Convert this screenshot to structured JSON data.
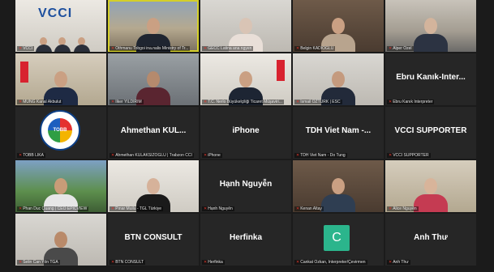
{
  "tiles": [
    {
      "name": "VCCI"
    },
    {
      "name": "Othmanu Tobgoi ina.nalis Ministry of Tr..."
    },
    {
      "name": "GECC Latina ana ngyen"
    },
    {
      "name": "Belgin KADIOGLU"
    },
    {
      "name": "Alper Özel"
    },
    {
      "name": "MÜNG Kanal Akbulut"
    },
    {
      "name": "İlker YILDIRIM"
    },
    {
      "name": "T.C. Nerlo Büyükelçiliği Ticaret Müşaviri..."
    },
    {
      "name": "İsmail ÖZTÜRK | ESC"
    },
    {
      "name": "Ebru Kanık Interpreter",
      "big": "Ebru Kanık-Inter..."
    },
    {
      "name": "TOBB LİKA",
      "logo": "TOBB"
    },
    {
      "name": "Ahmethan KULAKSIZOĞLU | Trabzon CCI",
      "big": "Ahmethan KUL..."
    },
    {
      "name": "iPhone",
      "big": "iPhone"
    },
    {
      "name": "TDH Viet Nam - Do Tung",
      "big": "TDH Viet Nam -..."
    },
    {
      "name": "VCCI SUPPORTER",
      "big": "VCCI SUPPORTER"
    },
    {
      "name": "Phan Duc Quang | CEO EPICVIEW"
    },
    {
      "name": "Pınar Muilu - TGL Türkiye"
    },
    {
      "name": "Hạnh Nguyễn",
      "big": "Hạnh Nguyễn"
    },
    {
      "name": "Kenan Altay"
    },
    {
      "name": "Alice Nguyễn"
    },
    {
      "name": "Selin Can Yön TGA"
    },
    {
      "name": "BTN CONSULT",
      "big": "BTN CONSULT"
    },
    {
      "name": "Herfinka",
      "big": "Herfinka"
    },
    {
      "name": "Cankat Özkan, Interpreter/Çevirmen",
      "avatar": "C"
    },
    {
      "name": "Anh Thư",
      "big": "Anh Thư"
    }
  ],
  "colors": {
    "active_border": "#d4cf2a",
    "mic_muted": "#e0352b",
    "avatar_bg": "#2bb58c"
  },
  "icons": {
    "mic": "muted-mic-icon"
  }
}
